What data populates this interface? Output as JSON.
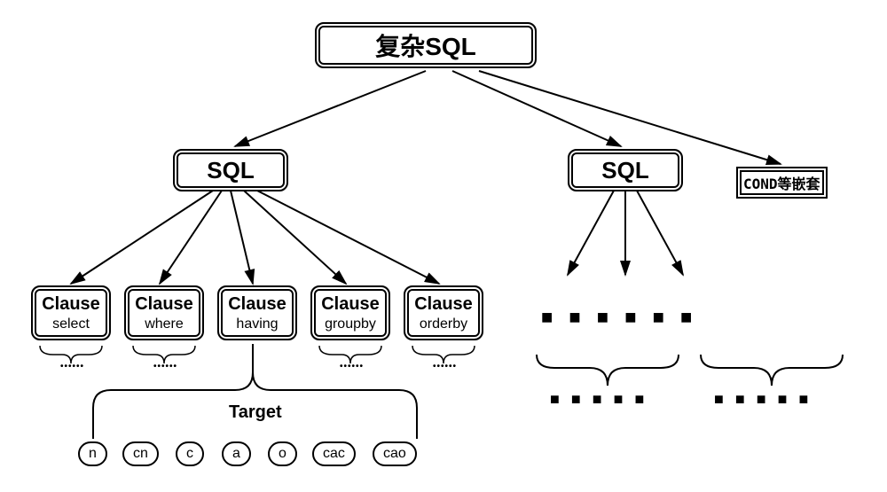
{
  "root": {
    "label": "复杂SQL"
  },
  "sql_left": {
    "label": "SQL"
  },
  "sql_right": {
    "label": "SQL"
  },
  "cond_box": {
    "label": "COND等嵌套"
  },
  "clauses": [
    {
      "title": "Clause",
      "sub": "select"
    },
    {
      "title": "Clause",
      "sub": "where"
    },
    {
      "title": "Clause",
      "sub": "having"
    },
    {
      "title": "Clause",
      "sub": "groupby"
    },
    {
      "title": "Clause",
      "sub": "orderby"
    }
  ],
  "target_label": "Target",
  "targets": [
    "n",
    "cn",
    "c",
    "a",
    "o",
    "cac",
    "cao"
  ]
}
